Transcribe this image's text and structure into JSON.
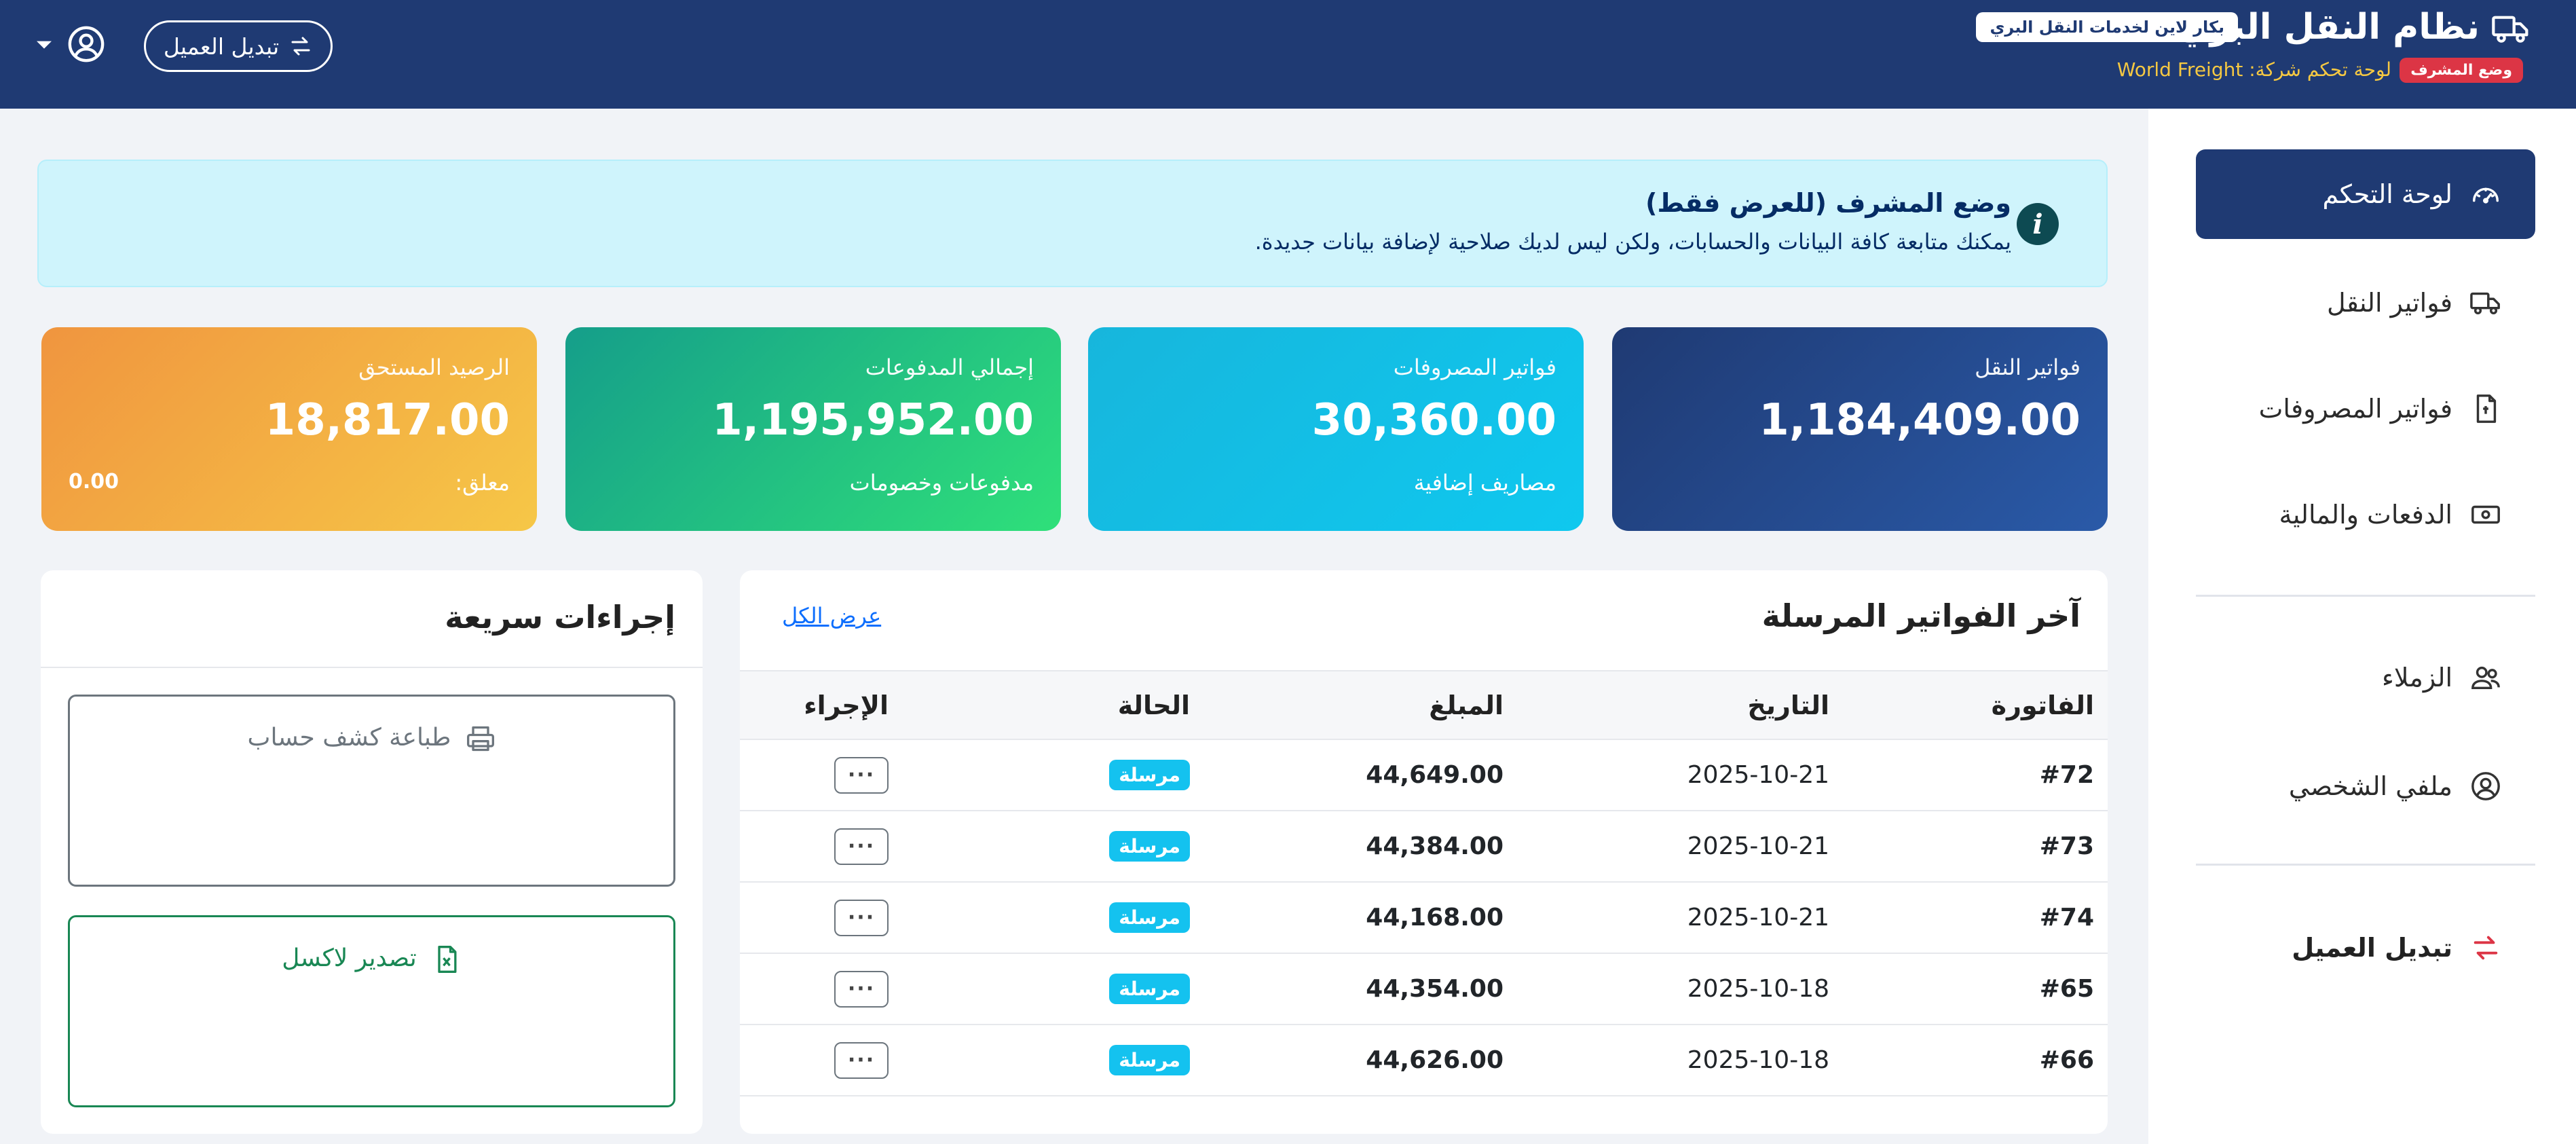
{
  "header": {
    "title": "نظام النقل البري",
    "company_badge": "بكار لاين لخدمات النقل البري",
    "role_badge": "وضع المشرف",
    "company_line": "لوحة تحكم شركة: World Freight",
    "switch_client": "تبديل العميل"
  },
  "sidebar": {
    "items": [
      {
        "label": "لوحة التحكم",
        "icon": "speedometer-icon",
        "active": true
      },
      {
        "label": "فواتير النقل",
        "icon": "truck-icon"
      },
      {
        "label": "فواتير المصروفات",
        "icon": "file-icon"
      },
      {
        "label": "الدفعات والمالية",
        "icon": "cash-icon"
      },
      {
        "label": "الزملاء",
        "icon": "people-icon"
      },
      {
        "label": "ملفي الشخصي",
        "icon": "person-circle-icon"
      },
      {
        "label": "تبديل العميل",
        "icon": "swap-arrows-icon"
      }
    ]
  },
  "alert": {
    "title": "وضع المشرف (للعرض فقط)",
    "text": "يمكنك متابعة كافة البيانات والحسابات، ولكن ليس لديك صلاحية لإضافة بيانات جديدة."
  },
  "stats": [
    {
      "label": "فواتير النقل",
      "value": "1,184,409.00",
      "sub": ""
    },
    {
      "label": "فواتير المصروفات",
      "value": "30,360.00",
      "sub": "مصاريف إضافية"
    },
    {
      "label": "إجمالي المدفوعات",
      "value": "1,195,952.00",
      "sub": "مدفوعات وخصومات"
    },
    {
      "label": "الرصيد المستحق",
      "value": "18,817.00",
      "sub": "معلق:",
      "sub_value": "0.00"
    }
  ],
  "invoices": {
    "title": "آخر الفواتير المرسلة",
    "view_all": "عرض الكل",
    "columns": [
      "الفاتورة",
      "التاريخ",
      "المبلغ",
      "الحالة",
      "الإجراء"
    ],
    "rows": [
      {
        "id": "#72",
        "date": "2025-10-21",
        "amount": "44,649.00",
        "status": "مرسلة"
      },
      {
        "id": "#73",
        "date": "2025-10-21",
        "amount": "44,384.00",
        "status": "مرسلة"
      },
      {
        "id": "#74",
        "date": "2025-10-21",
        "amount": "44,168.00",
        "status": "مرسلة"
      },
      {
        "id": "#65",
        "date": "2025-10-18",
        "amount": "44,354.00",
        "status": "مرسلة"
      },
      {
        "id": "#66",
        "date": "2025-10-18",
        "amount": "44,626.00",
        "status": "مرسلة"
      }
    ],
    "action_label": "···"
  },
  "quick_actions": {
    "title": "إجراءات سريعة",
    "print": "طباعة كشف حساب",
    "excel": "تصدير لاكسل"
  },
  "colors": {
    "navy": "#1f3a73",
    "info_bg": "#cff4fc",
    "status_sent": "#14c2ef",
    "danger": "#dc3545",
    "success": "#198754"
  }
}
